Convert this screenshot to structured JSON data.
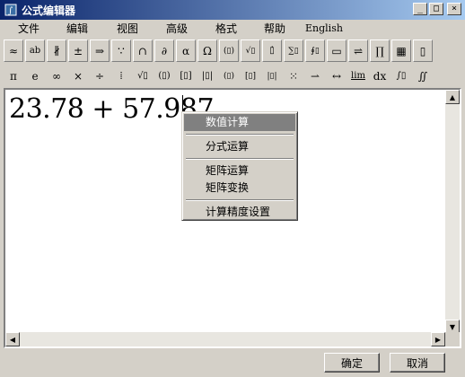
{
  "window": {
    "title": "公式编辑器",
    "minimize_glyph": "_",
    "maximize_glyph": "□",
    "close_glyph": "×"
  },
  "menu": [
    {
      "label": "文件"
    },
    {
      "label": "编辑"
    },
    {
      "label": "视图"
    },
    {
      "label": "高级"
    },
    {
      "label": "格式"
    },
    {
      "label": "帮助"
    },
    {
      "label": "English"
    }
  ],
  "toolbar1": [
    {
      "glyph": "≈",
      "icon": "approx-icon"
    },
    {
      "glyph": "ab",
      "icon": "spacing-icon"
    },
    {
      "glyph": "∦",
      "icon": "embellishment-icon"
    },
    {
      "glyph": "±",
      "icon": "operator-icon"
    },
    {
      "glyph": "⇒",
      "icon": "arrow-icon"
    },
    {
      "glyph": "∵",
      "icon": "logic-icon"
    },
    {
      "glyph": "∩",
      "icon": "set-icon"
    },
    {
      "glyph": "∂",
      "icon": "misc-symbol-icon"
    },
    {
      "glyph": "α",
      "icon": "greek-lower-icon"
    },
    {
      "glyph": "Ω",
      "icon": "greek-upper-icon"
    },
    {
      "glyph": "(▯)",
      "icon": "fence-template-icon"
    },
    {
      "glyph": "√▯",
      "icon": "fraction-radical-icon"
    },
    {
      "glyph": "▯̇",
      "icon": "subscript-template-icon"
    },
    {
      "glyph": "∑▯",
      "icon": "summation-template-icon"
    },
    {
      "glyph": "∮▯",
      "icon": "integral-template-icon"
    },
    {
      "glyph": "▭",
      "icon": "bar-template-icon"
    },
    {
      "glyph": "⇌",
      "icon": "labeled-arrow-icon"
    },
    {
      "glyph": "∏",
      "icon": "product-template-icon"
    },
    {
      "glyph": "▦",
      "icon": "matrix-template-icon"
    },
    {
      "glyph": "▯",
      "icon": "box-template-icon"
    }
  ],
  "toolbar2": [
    {
      "glyph": "π",
      "icon": "pi-icon"
    },
    {
      "glyph": "e",
      "icon": "euler-icon"
    },
    {
      "glyph": "∞",
      "icon": "infinity-icon"
    },
    {
      "glyph": "×",
      "icon": "times-icon"
    },
    {
      "glyph": "÷",
      "icon": "divide-icon"
    },
    {
      "glyph": "⁞",
      "icon": "fraction-icon"
    },
    {
      "glyph": "√▯",
      "icon": "sqrt-icon"
    },
    {
      "glyph": "(▯)",
      "icon": "parentheses-icon"
    },
    {
      "glyph": "[▯]",
      "icon": "brackets-icon"
    },
    {
      "glyph": "|▯|",
      "icon": "absolute-icon"
    },
    {
      "glyph": "(▯)",
      "icon": "binomial-icon"
    },
    {
      "glyph": "[▯]",
      "icon": "matrix-bracket-icon"
    },
    {
      "glyph": "|▯|",
      "icon": "determinant-icon"
    },
    {
      "glyph": "⁙",
      "icon": "matrix-grid-icon"
    },
    {
      "glyph": "⇀",
      "icon": "vector-arrow-icon"
    },
    {
      "glyph": "↔",
      "icon": "double-arrow-icon"
    },
    {
      "glyph": "lim",
      "icon": "limit-icon"
    },
    {
      "glyph": "dx",
      "icon": "differential-icon"
    },
    {
      "glyph": "∫▯",
      "icon": "integral-icon"
    },
    {
      "glyph": "∬",
      "icon": "double-integral-icon"
    }
  ],
  "editor": {
    "formula": "23.78 + 57.987"
  },
  "context_menu": {
    "items": [
      {
        "label": "数值计算",
        "active": true
      },
      {
        "label": "分式运算"
      },
      {
        "label": "矩阵运算"
      },
      {
        "label": "矩阵变换"
      },
      {
        "label": "计算精度设置"
      }
    ]
  },
  "buttons": {
    "ok": "确定",
    "cancel": "取消"
  }
}
